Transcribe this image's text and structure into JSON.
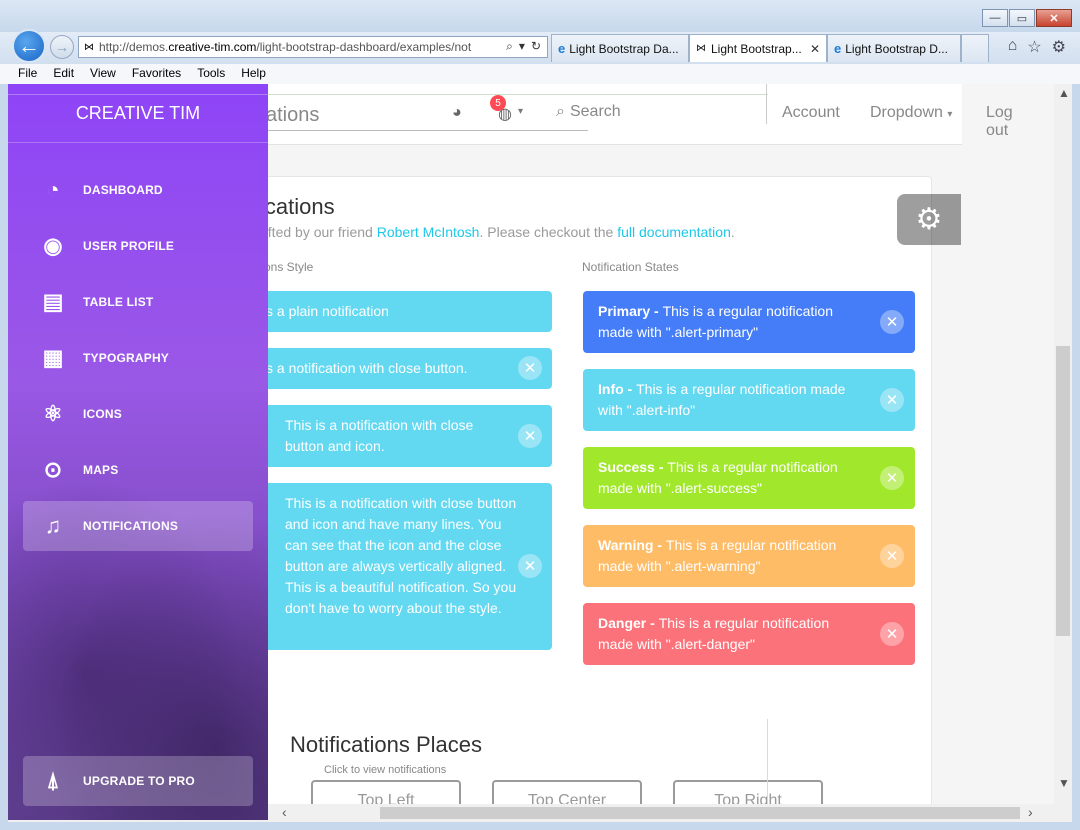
{
  "browser": {
    "address": {
      "prefix": "http://demos.",
      "host": "creative-tim.com",
      "path": "/light-bootstrap-dashboard/examples/not"
    },
    "tabs": [
      {
        "label": "Light Bootstrap Da...",
        "active": false
      },
      {
        "label": "Light Bootstrap...",
        "active": true
      },
      {
        "label": "Light Bootstrap D...",
        "active": false
      }
    ],
    "menu": [
      "File",
      "Edit",
      "View",
      "Favorites",
      "Tools",
      "Help"
    ],
    "window_buttons": {
      "minimize": "—",
      "restore": "▭",
      "close": "✕"
    },
    "icons": [
      "home-icon",
      "star-icon",
      "gear-icon"
    ]
  },
  "sidebar": {
    "logo": "CREATIVE TIM",
    "items": [
      {
        "label": "DASHBOARD",
        "icon": "pie-chart-icon"
      },
      {
        "label": "USER PROFILE",
        "icon": "user-circle-icon"
      },
      {
        "label": "TABLE LIST",
        "icon": "clipboard-icon"
      },
      {
        "label": "TYPOGRAPHY",
        "icon": "news-icon"
      },
      {
        "label": "ICONS",
        "icon": "atom-icon"
      },
      {
        "label": "MAPS",
        "icon": "pin-icon"
      },
      {
        "label": "NOTIFICATIONS",
        "icon": "bell-icon",
        "active": true
      }
    ],
    "upgrade": {
      "label": "UPGRADE TO PRO",
      "icon": "rocket-icon"
    }
  },
  "topnav": {
    "brand": "ations",
    "badge": "5",
    "search": "Search",
    "account": "Account",
    "dropdown": "Dropdown",
    "logout": "Log out"
  },
  "card": {
    "title": "ications",
    "subtitle_pre": "afted by our friend ",
    "subtitle_link1": "Robert McIntosh",
    "subtitle_mid": ". Please checkout the ",
    "subtitle_link2": "full documentation",
    "subtitle_end": ".",
    "col_left": "ons Style",
    "col_right": "Notification States"
  },
  "left_alerts": [
    {
      "text": "s a plain notification"
    },
    {
      "text": "s a notification with close button."
    },
    {
      "text": "This is a notification with close button and icon."
    },
    {
      "text": "This is a notification with close button and icon and have many lines. You can see that the icon and the close button are always vertically aligned. This is a beautiful notification. So you don't have to worry about the style."
    }
  ],
  "state_alerts": [
    {
      "strong": "Primary - ",
      "text": "This is a regular notification made with \".alert-primary\""
    },
    {
      "strong": "Info - ",
      "text": "This is a regular notification made with \".alert-info\""
    },
    {
      "strong": "Success - ",
      "text": "This is a regular notification made with \".alert-success\""
    },
    {
      "strong": "Warning - ",
      "text": "This is a regular notification made with \".alert-warning\""
    },
    {
      "strong": "Danger - ",
      "text": "This is a regular notification made with \".alert-danger\""
    }
  ],
  "places": {
    "title": "Notifications Places",
    "subtitle": "Click to view notifications",
    "buttons": [
      "Top Left",
      "Top Center",
      "Top Right"
    ]
  },
  "colors": {
    "info": "#63d8f1",
    "primary": "#447df7",
    "success": "#a1e82c",
    "warning": "#ffbc67",
    "danger": "#fc727a",
    "sidebar": "#8e44f7"
  }
}
